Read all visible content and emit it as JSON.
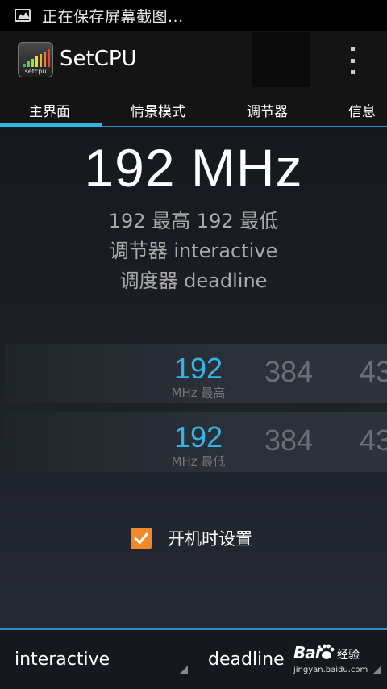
{
  "status_bar": {
    "icon": "image-icon",
    "text": "正在保存屏幕截图..."
  },
  "action_bar": {
    "app_icon_label": "setcpu",
    "title": "SetCPU",
    "menu_icon": "overflow-menu-icon"
  },
  "tabs": [
    {
      "label": "主界面",
      "selected": true
    },
    {
      "label": "情景模式",
      "selected": false
    },
    {
      "label": "调节器",
      "selected": false
    },
    {
      "label": "信息",
      "selected": false
    }
  ],
  "main": {
    "current_freq": "192 MHz",
    "max_min_line": "192 最高 192 最低",
    "governor_line": "调节器 interactive",
    "scheduler_line": "调度器 deadline"
  },
  "pickers": {
    "max": {
      "selected": "192",
      "unit_label": "MHz 最高",
      "next": "384",
      "next2": "43"
    },
    "min": {
      "selected": "192",
      "unit_label": "MHz 最低",
      "next": "384",
      "next2": "43"
    }
  },
  "boot_setting": {
    "label": "开机时设置",
    "checked": true
  },
  "bottom": {
    "governor_spinner": "interactive",
    "scheduler_spinner": "deadline"
  },
  "watermark": {
    "brand": "Bai",
    "brand_suffix": "经验",
    "url": "jingyan.baidu.com"
  },
  "colors": {
    "accent": "#33b5e5",
    "checkbox": "#f0892a"
  }
}
